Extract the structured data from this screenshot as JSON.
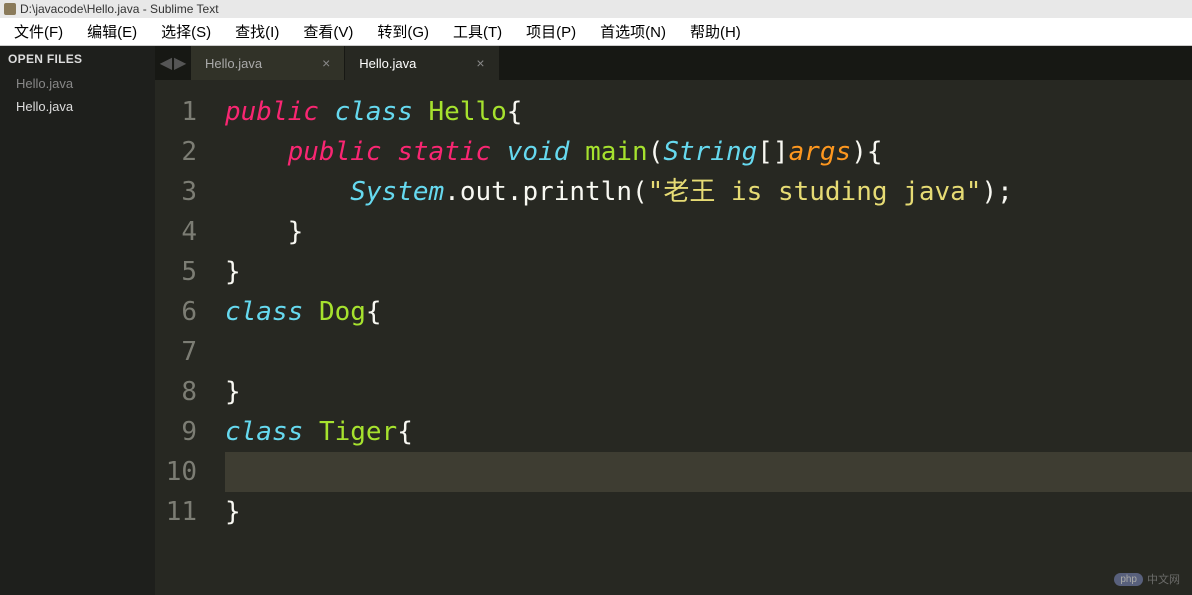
{
  "title": "D:\\javacode\\Hello.java - Sublime Text",
  "menu": [
    "文件(F)",
    "编辑(E)",
    "选择(S)",
    "查找(I)",
    "查看(V)",
    "转到(G)",
    "工具(T)",
    "项目(P)",
    "首选项(N)",
    "帮助(H)"
  ],
  "sidebar": {
    "header": "OPEN FILES",
    "files": [
      {
        "name": "Hello.java",
        "active": false
      },
      {
        "name": "Hello.java",
        "active": true
      }
    ]
  },
  "tabs": [
    {
      "name": "Hello.java",
      "active": false
    },
    {
      "name": "Hello.java",
      "active": true
    }
  ],
  "code": {
    "line_count": 11,
    "current_line": 10,
    "tokens": [
      [
        {
          "t": "public",
          "c": "kw-red"
        },
        {
          "t": " ",
          "c": "kw-white"
        },
        {
          "t": "class",
          "c": "kw-blue"
        },
        {
          "t": " ",
          "c": "kw-white"
        },
        {
          "t": "Hello",
          "c": "kw-green"
        },
        {
          "t": "{",
          "c": "kw-white"
        }
      ],
      [
        {
          "t": "    ",
          "c": "kw-white"
        },
        {
          "t": "public",
          "c": "kw-red"
        },
        {
          "t": " ",
          "c": "kw-white"
        },
        {
          "t": "static",
          "c": "kw-red"
        },
        {
          "t": " ",
          "c": "kw-white"
        },
        {
          "t": "void",
          "c": "kw-blue"
        },
        {
          "t": " ",
          "c": "kw-white"
        },
        {
          "t": "main",
          "c": "kw-green"
        },
        {
          "t": "(",
          "c": "kw-white"
        },
        {
          "t": "String",
          "c": "kw-blue"
        },
        {
          "t": "[]",
          "c": "kw-white"
        },
        {
          "t": "args",
          "c": "kw-orange"
        },
        {
          "t": "){",
          "c": "kw-white"
        }
      ],
      [
        {
          "t": "        ",
          "c": "kw-white"
        },
        {
          "t": "System",
          "c": "kw-blue"
        },
        {
          "t": ".",
          "c": "kw-white"
        },
        {
          "t": "out",
          "c": "kw-white"
        },
        {
          "t": ".",
          "c": "kw-white"
        },
        {
          "t": "println",
          "c": "kw-white"
        },
        {
          "t": "(",
          "c": "kw-white"
        },
        {
          "t": "\"老王 is studing java\"",
          "c": "kw-str"
        },
        {
          "t": ");",
          "c": "kw-white"
        }
      ],
      [
        {
          "t": "    }",
          "c": "kw-white"
        }
      ],
      [
        {
          "t": "}",
          "c": "kw-white"
        }
      ],
      [
        {
          "t": "class",
          "c": "kw-blue"
        },
        {
          "t": " ",
          "c": "kw-white"
        },
        {
          "t": "Dog",
          "c": "kw-green"
        },
        {
          "t": "{",
          "c": "kw-white"
        }
      ],
      [],
      [
        {
          "t": "}",
          "c": "kw-white"
        }
      ],
      [
        {
          "t": "class",
          "c": "kw-blue"
        },
        {
          "t": " ",
          "c": "kw-white"
        },
        {
          "t": "Tiger",
          "c": "kw-green"
        },
        {
          "t": "{",
          "c": "kw-white"
        }
      ],
      [],
      [
        {
          "t": "}",
          "c": "kw-white"
        }
      ]
    ]
  },
  "watermark": {
    "badge": "php",
    "text": "中文网"
  }
}
